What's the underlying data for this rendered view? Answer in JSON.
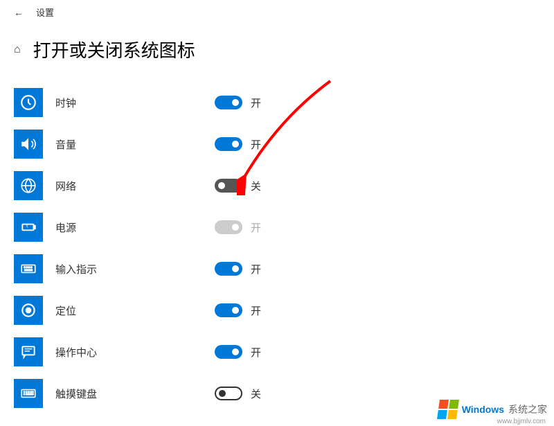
{
  "header": {
    "title": "设置"
  },
  "page": {
    "title": "打开或关闭系统图标"
  },
  "toggleLabels": {
    "on": "开",
    "off": "关"
  },
  "settings": [
    {
      "label": "时钟",
      "state": "on",
      "stateLabel": "开"
    },
    {
      "label": "音量",
      "state": "on",
      "stateLabel": "开"
    },
    {
      "label": "网络",
      "state": "off-dark",
      "stateLabel": "关"
    },
    {
      "label": "电源",
      "state": "disabled",
      "stateLabel": "开"
    },
    {
      "label": "输入指示",
      "state": "on",
      "stateLabel": "开"
    },
    {
      "label": "定位",
      "state": "on",
      "stateLabel": "开"
    },
    {
      "label": "操作中心",
      "state": "on",
      "stateLabel": "开"
    },
    {
      "label": "触摸键盘",
      "state": "off-outline",
      "stateLabel": "关"
    }
  ],
  "watermark": {
    "brand": "Windows",
    "suffix": "系统之家",
    "url": "www.bjjmlv.com"
  }
}
